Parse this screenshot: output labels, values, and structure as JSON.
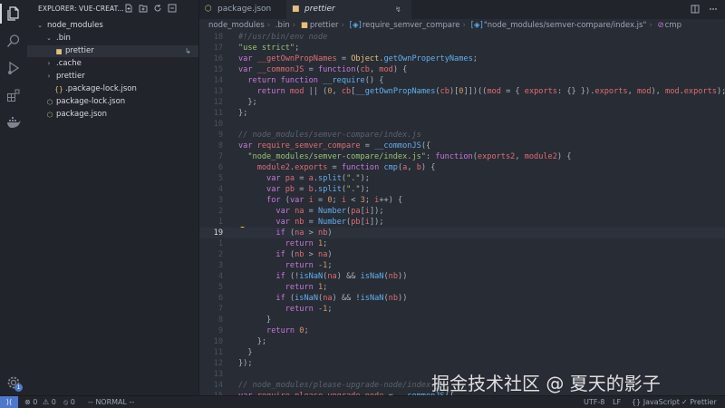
{
  "explorer": {
    "header": "EXPLORER: VUE-CREAT...",
    "tree": [
      {
        "label": "node_modules",
        "chevron": "⌄",
        "icon": "",
        "indent": 0,
        "color": "#d7dae0"
      },
      {
        "label": ".bin",
        "chevron": "⌄",
        "icon": "",
        "indent": 1,
        "color": "#d7dae0"
      },
      {
        "label": "prettier",
        "chevron": "",
        "icon": "■",
        "iconColor": "#e5c07b",
        "indent": 2,
        "color": "#d7dae0",
        "selected": true,
        "symlink": "↳"
      },
      {
        "label": ".cache",
        "chevron": "›",
        "icon": "",
        "indent": 1,
        "color": "#d7dae0"
      },
      {
        "label": "prettier",
        "chevron": "›",
        "icon": "",
        "indent": 1,
        "color": "#d7dae0"
      },
      {
        "label": ".package-lock.json",
        "chevron": "",
        "icon": "{}",
        "iconColor": "#e5c07b",
        "indent": 2,
        "color": "#d7dae0"
      },
      {
        "label": "package-lock.json",
        "chevron": "",
        "icon": "⬡",
        "iconColor": "#98c379",
        "indent": 1,
        "color": "#d7dae0"
      },
      {
        "label": "package.json",
        "chevron": "",
        "icon": "⬡",
        "iconColor": "#98c379",
        "indent": 1,
        "color": "#d7dae0"
      }
    ]
  },
  "tabs": [
    {
      "label": "package.json",
      "icon": "⬡",
      "iconColor": "#98c379",
      "active": false
    },
    {
      "label": "prettier",
      "icon": "■",
      "iconColor": "#e5c07b",
      "active": true,
      "pin": "↯"
    }
  ],
  "breadcrumb": [
    "node_modules",
    ".bin",
    "prettier",
    "require_semver_compare",
    "\"node_modules/semver-compare/index.js\"",
    "cmp"
  ],
  "breadcrumb_icons": {
    "prettier": "■",
    "require_semver_compare": "[◈]",
    "\"node_modules/semver-compare/index.js\"": "[◈]",
    "cmp": "⊘"
  },
  "editor": {
    "current_line_index": 19,
    "lines": [
      {
        "n": "18",
        "tokens": [
          [
            "c",
            "#!/usr/bin/env node"
          ]
        ]
      },
      {
        "n": "17",
        "tokens": [
          [
            "s",
            "\"use strict\""
          ],
          [
            "v",
            ";"
          ]
        ]
      },
      {
        "n": "16",
        "tokens": [
          [
            "k",
            "var "
          ],
          [
            "p",
            "__getOwnPropNames"
          ],
          [
            "v",
            " = "
          ],
          [
            "y",
            "Object"
          ],
          [
            "v",
            "."
          ],
          [
            "f",
            "getOwnPropertyNames"
          ],
          [
            "v",
            ";"
          ]
        ]
      },
      {
        "n": "15",
        "tokens": [
          [
            "k",
            "var "
          ],
          [
            "p",
            "__commonJS"
          ],
          [
            "v",
            " = "
          ],
          [
            "k",
            "function"
          ],
          [
            "v",
            "("
          ],
          [
            "p",
            "cb"
          ],
          [
            "v",
            ", "
          ],
          [
            "p",
            "mod"
          ],
          [
            "v",
            ") {"
          ]
        ]
      },
      {
        "n": "14",
        "tokens": [
          [
            "v",
            "  "
          ],
          [
            "k",
            "return "
          ],
          [
            "k",
            "function "
          ],
          [
            "f",
            "__require"
          ],
          [
            "v",
            "() {"
          ]
        ]
      },
      {
        "n": "13",
        "tokens": [
          [
            "v",
            "    "
          ],
          [
            "k",
            "return "
          ],
          [
            "p",
            "mod"
          ],
          [
            "v",
            " || ("
          ],
          [
            "n",
            "0"
          ],
          [
            "v",
            ", "
          ],
          [
            "p",
            "cb"
          ],
          [
            "v",
            "["
          ],
          [
            "f",
            "__getOwnPropNames"
          ],
          [
            "v",
            "("
          ],
          [
            "p",
            "cb"
          ],
          [
            "v",
            ")["
          ],
          [
            "n",
            "0"
          ],
          [
            "v",
            "]])(("
          ],
          [
            "p",
            "mod"
          ],
          [
            "v",
            " = { "
          ],
          [
            "p",
            "exports"
          ],
          [
            "v",
            ": {} })."
          ],
          [
            "p",
            "exports"
          ],
          [
            "v",
            ", "
          ],
          [
            "p",
            "mod"
          ],
          [
            "v",
            "), "
          ],
          [
            "p",
            "mod"
          ],
          [
            "v",
            "."
          ],
          [
            "p",
            "exports"
          ],
          [
            "v",
            ");"
          ]
        ]
      },
      {
        "n": "12",
        "tokens": [
          [
            "v",
            "  };"
          ]
        ]
      },
      {
        "n": "11",
        "tokens": [
          [
            "v",
            "};"
          ]
        ]
      },
      {
        "n": "10",
        "tokens": []
      },
      {
        "n": "9",
        "tokens": [
          [
            "c",
            "// node_modules/semver-compare/index.js"
          ]
        ]
      },
      {
        "n": "8",
        "tokens": [
          [
            "k",
            "var "
          ],
          [
            "p",
            "require_semver_compare"
          ],
          [
            "v",
            " = "
          ],
          [
            "f",
            "__commonJS"
          ],
          [
            "v",
            "({"
          ]
        ]
      },
      {
        "n": "7",
        "tokens": [
          [
            "v",
            "  "
          ],
          [
            "s",
            "\"node_modules/semver-compare/index.js\""
          ],
          [
            "v",
            ": "
          ],
          [
            "k",
            "function"
          ],
          [
            "v",
            "("
          ],
          [
            "p",
            "exports2"
          ],
          [
            "v",
            ", "
          ],
          [
            "p",
            "module2"
          ],
          [
            "v",
            ") {"
          ]
        ]
      },
      {
        "n": "6",
        "tokens": [
          [
            "v",
            "    "
          ],
          [
            "p",
            "module2"
          ],
          [
            "v",
            "."
          ],
          [
            "p",
            "exports"
          ],
          [
            "v",
            " = "
          ],
          [
            "k",
            "function "
          ],
          [
            "f",
            "cmp"
          ],
          [
            "v",
            "("
          ],
          [
            "p",
            "a"
          ],
          [
            "v",
            ", "
          ],
          [
            "p",
            "b"
          ],
          [
            "v",
            ") {"
          ]
        ]
      },
      {
        "n": "5",
        "tokens": [
          [
            "v",
            "      "
          ],
          [
            "k",
            "var "
          ],
          [
            "p",
            "pa"
          ],
          [
            "v",
            " = "
          ],
          [
            "p",
            "a"
          ],
          [
            "v",
            "."
          ],
          [
            "f",
            "split"
          ],
          [
            "v",
            "("
          ],
          [
            "s",
            "\".\""
          ],
          [
            "v",
            ");"
          ]
        ]
      },
      {
        "n": "4",
        "tokens": [
          [
            "v",
            "      "
          ],
          [
            "k",
            "var "
          ],
          [
            "p",
            "pb"
          ],
          [
            "v",
            " = "
          ],
          [
            "p",
            "b"
          ],
          [
            "v",
            "."
          ],
          [
            "f",
            "split"
          ],
          [
            "v",
            "("
          ],
          [
            "s",
            "\".\""
          ],
          [
            "v",
            ");"
          ]
        ]
      },
      {
        "n": "3",
        "tokens": [
          [
            "v",
            "      "
          ],
          [
            "k",
            "for "
          ],
          [
            "v",
            "("
          ],
          [
            "k",
            "var "
          ],
          [
            "p",
            "i"
          ],
          [
            "v",
            " = "
          ],
          [
            "n",
            "0"
          ],
          [
            "v",
            "; "
          ],
          [
            "p",
            "i"
          ],
          [
            "v",
            " < "
          ],
          [
            "n",
            "3"
          ],
          [
            "v",
            "; "
          ],
          [
            "p",
            "i"
          ],
          [
            "v",
            "++) {"
          ]
        ]
      },
      {
        "n": "2",
        "tokens": [
          [
            "v",
            "        "
          ],
          [
            "k",
            "var "
          ],
          [
            "p",
            "na"
          ],
          [
            "v",
            " = "
          ],
          [
            "f",
            "Number"
          ],
          [
            "v",
            "("
          ],
          [
            "p",
            "pa"
          ],
          [
            "v",
            "["
          ],
          [
            "p",
            "i"
          ],
          [
            "v",
            "]);"
          ]
        ]
      },
      {
        "n": "1",
        "tokens": [
          [
            "v",
            "        "
          ],
          [
            "k",
            "var "
          ],
          [
            "p",
            "nb"
          ],
          [
            "v",
            " = "
          ],
          [
            "f",
            "Number"
          ],
          [
            "v",
            "("
          ],
          [
            "p",
            "pb"
          ],
          [
            "v",
            "["
          ],
          [
            "p",
            "i"
          ],
          [
            "v",
            "]);"
          ]
        ]
      },
      {
        "n": "19",
        "tokens": [
          [
            "v",
            "        "
          ],
          [
            "k",
            "if "
          ],
          [
            "v",
            "("
          ],
          [
            "p",
            "na"
          ],
          [
            "v",
            " > "
          ],
          [
            "p",
            "nb"
          ],
          [
            "v",
            ")"
          ]
        ],
        "current": true
      },
      {
        "n": "1",
        "tokens": [
          [
            "v",
            "          "
          ],
          [
            "k",
            "return "
          ],
          [
            "n",
            "1"
          ],
          [
            "v",
            ";"
          ]
        ]
      },
      {
        "n": "2",
        "tokens": [
          [
            "v",
            "        "
          ],
          [
            "k",
            "if "
          ],
          [
            "v",
            "("
          ],
          [
            "p",
            "nb"
          ],
          [
            "v",
            " > "
          ],
          [
            "p",
            "na"
          ],
          [
            "v",
            ")"
          ]
        ]
      },
      {
        "n": "3",
        "tokens": [
          [
            "v",
            "          "
          ],
          [
            "k",
            "return "
          ],
          [
            "v",
            "-"
          ],
          [
            "n",
            "1"
          ],
          [
            "v",
            ";"
          ]
        ]
      },
      {
        "n": "4",
        "tokens": [
          [
            "v",
            "        "
          ],
          [
            "k",
            "if "
          ],
          [
            "v",
            "(!"
          ],
          [
            "f",
            "isNaN"
          ],
          [
            "v",
            "("
          ],
          [
            "p",
            "na"
          ],
          [
            "v",
            ") && "
          ],
          [
            "f",
            "isNaN"
          ],
          [
            "v",
            "("
          ],
          [
            "p",
            "nb"
          ],
          [
            "v",
            "))"
          ]
        ]
      },
      {
        "n": "5",
        "tokens": [
          [
            "v",
            "          "
          ],
          [
            "k",
            "return "
          ],
          [
            "n",
            "1"
          ],
          [
            "v",
            ";"
          ]
        ]
      },
      {
        "n": "6",
        "tokens": [
          [
            "v",
            "        "
          ],
          [
            "k",
            "if "
          ],
          [
            "v",
            "("
          ],
          [
            "f",
            "isNaN"
          ],
          [
            "v",
            "("
          ],
          [
            "p",
            "na"
          ],
          [
            "v",
            ") && !"
          ],
          [
            "f",
            "isNaN"
          ],
          [
            "v",
            "("
          ],
          [
            "p",
            "nb"
          ],
          [
            "v",
            "))"
          ]
        ]
      },
      {
        "n": "7",
        "tokens": [
          [
            "v",
            "          "
          ],
          [
            "k",
            "return "
          ],
          [
            "v",
            "-"
          ],
          [
            "n",
            "1"
          ],
          [
            "v",
            ";"
          ]
        ]
      },
      {
        "n": "8",
        "tokens": [
          [
            "v",
            "      }"
          ]
        ]
      },
      {
        "n": "9",
        "tokens": [
          [
            "v",
            "      "
          ],
          [
            "k",
            "return "
          ],
          [
            "n",
            "0"
          ],
          [
            "v",
            ";"
          ]
        ]
      },
      {
        "n": "10",
        "tokens": [
          [
            "v",
            "    };"
          ]
        ]
      },
      {
        "n": "11",
        "tokens": [
          [
            "v",
            "  }"
          ]
        ]
      },
      {
        "n": "12",
        "tokens": [
          [
            "v",
            "});"
          ]
        ]
      },
      {
        "n": "13",
        "tokens": []
      },
      {
        "n": "14",
        "tokens": [
          [
            "c",
            "// node_modules/please-upgrade-node/index.js"
          ]
        ]
      },
      {
        "n": "15",
        "tokens": [
          [
            "k",
            "var "
          ],
          [
            "p",
            "require_please_upgrade_node"
          ],
          [
            "v",
            " = "
          ],
          [
            "f",
            "__commonJS"
          ],
          [
            "v",
            "({"
          ]
        ]
      }
    ]
  },
  "watermark": "掘金技术社区 @ 夏天的影子",
  "status": {
    "errors": "0",
    "warnings": "0",
    "ports": "0",
    "mode": "-- NORMAL --",
    "encoding": "UTF-8",
    "eol": "LF",
    "language": "{} JavaScript",
    "formatter": "✓ Prettier"
  },
  "colors": {
    "accent": "#4d78cc",
    "background": "#282c34",
    "sidebar": "#21252b"
  }
}
